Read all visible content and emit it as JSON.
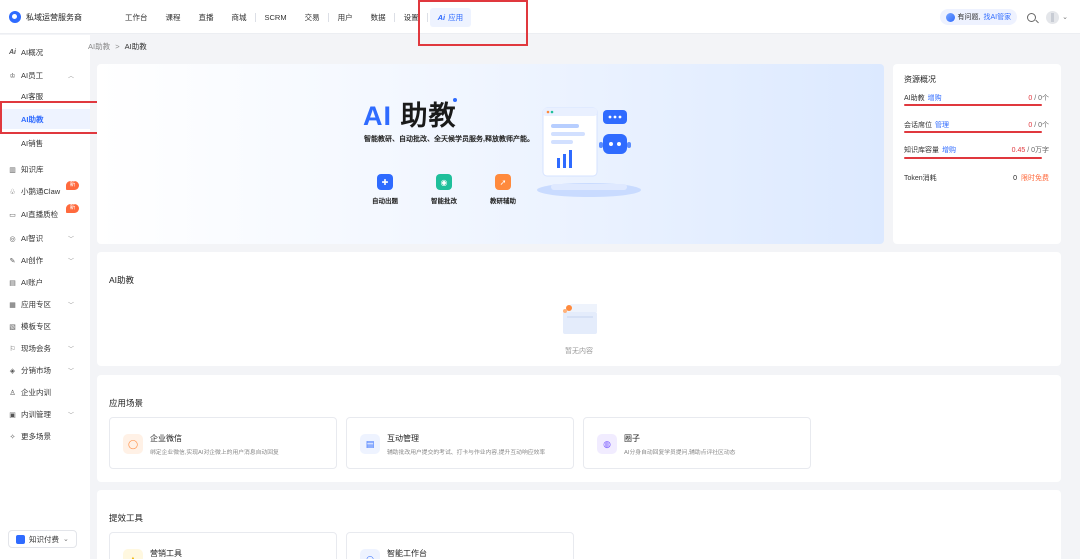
{
  "app": {
    "title": "私域运营服务商"
  },
  "nav": {
    "items": [
      "工作台",
      "课程",
      "直播",
      "商城",
      "SCRM",
      "交易",
      "用户",
      "数据",
      "设置"
    ],
    "active": "应用",
    "ai_glyph": "Ai"
  },
  "topright": {
    "ask_prefix": "有问题,",
    "ask_highlight": "找AI管家"
  },
  "sidebar": {
    "overview": "AI概况",
    "staff": "AI员工",
    "staff_children": [
      "AI客服",
      "AI助教",
      "AI销售"
    ],
    "items": [
      {
        "label": "知识库",
        "icon": "▥"
      },
      {
        "label": "小鹅通Claw",
        "icon": "♧",
        "badge": "新"
      },
      {
        "label": "AI直播质检",
        "icon": "▭",
        "badge": "新"
      },
      {
        "label": "AI智识",
        "icon": "◎",
        "arrow": true
      },
      {
        "label": "AI创作",
        "icon": "✎",
        "arrow": true
      },
      {
        "label": "AI账户",
        "icon": "▤"
      },
      {
        "label": "应用专区",
        "icon": "▦",
        "arrow": true
      },
      {
        "label": "模板专区",
        "icon": "▧"
      },
      {
        "label": "现场会务",
        "icon": "⚐",
        "arrow": true
      },
      {
        "label": "分销市场",
        "icon": "◈",
        "arrow": true
      },
      {
        "label": "企业内训",
        "icon": "♙"
      },
      {
        "label": "内训管理",
        "icon": "▣",
        "arrow": true
      },
      {
        "label": "更多场景",
        "icon": "✧"
      }
    ],
    "kb_pill": "知识付费"
  },
  "breadcrumb": {
    "parent": "AI助教",
    "sep": ">",
    "current": "AI助教"
  },
  "banner": {
    "title_ai": "AI",
    "title_rest": "助教",
    "desc": "智能教研、自动批改、全天候学员服务,释放教师产能。",
    "features": [
      {
        "label": "自动出题",
        "color": "#2f6bff",
        "glyph": "✚"
      },
      {
        "label": "智能批改",
        "color": "#1fbf9b",
        "glyph": "◉"
      },
      {
        "label": "教研辅助",
        "color": "#ff8a3d",
        "glyph": "➚"
      }
    ]
  },
  "resources": {
    "title": "资源概况",
    "rows": [
      {
        "label": "AI助教",
        "link": "增购",
        "used": "0",
        "total": "/ 0个"
      },
      {
        "label": "会话席位",
        "link": "管理",
        "used": "0",
        "total": "/ 0个"
      },
      {
        "label": "知识库容量",
        "link": "增购",
        "used": "0.45",
        "total": "/ 0万字"
      },
      {
        "label": "Token消耗",
        "link": "",
        "used": "0",
        "extra": "限时免费"
      }
    ]
  },
  "assistant_section": {
    "title": "AI助教",
    "empty": "暂无内容"
  },
  "scenes_section": {
    "title": "应用场景",
    "items": [
      {
        "name": "企业微信",
        "desc": "绑定企业微信,实现AI对企微上的用户消息自动回复",
        "bg": "#fff1e6",
        "fg": "#ff8a3d",
        "glyph": "◯"
      },
      {
        "name": "互动管理",
        "desc": "辅助批改用户提交的考试、打卡与作业内容,提升互动响应效率",
        "bg": "#eef3ff",
        "fg": "#2f6bff",
        "glyph": "▤"
      },
      {
        "name": "圈子",
        "desc": "AI分身自动回复学员提问,辅助点评社区动态",
        "bg": "#f1ecff",
        "fg": "#7a5cff",
        "glyph": "◍"
      }
    ]
  },
  "tools_section": {
    "title": "提效工具",
    "items": [
      {
        "name": "营销工具",
        "bg": "#fff8e0",
        "fg": "#f0b400",
        "glyph": "▲"
      },
      {
        "name": "智能工作台",
        "bg": "#eef3ff",
        "fg": "#2f6bff",
        "glyph": "◠"
      }
    ]
  },
  "colors": {
    "accent": "#2f6bff",
    "annotation_red": "#e0383e",
    "badge": "#ff6a3d"
  }
}
